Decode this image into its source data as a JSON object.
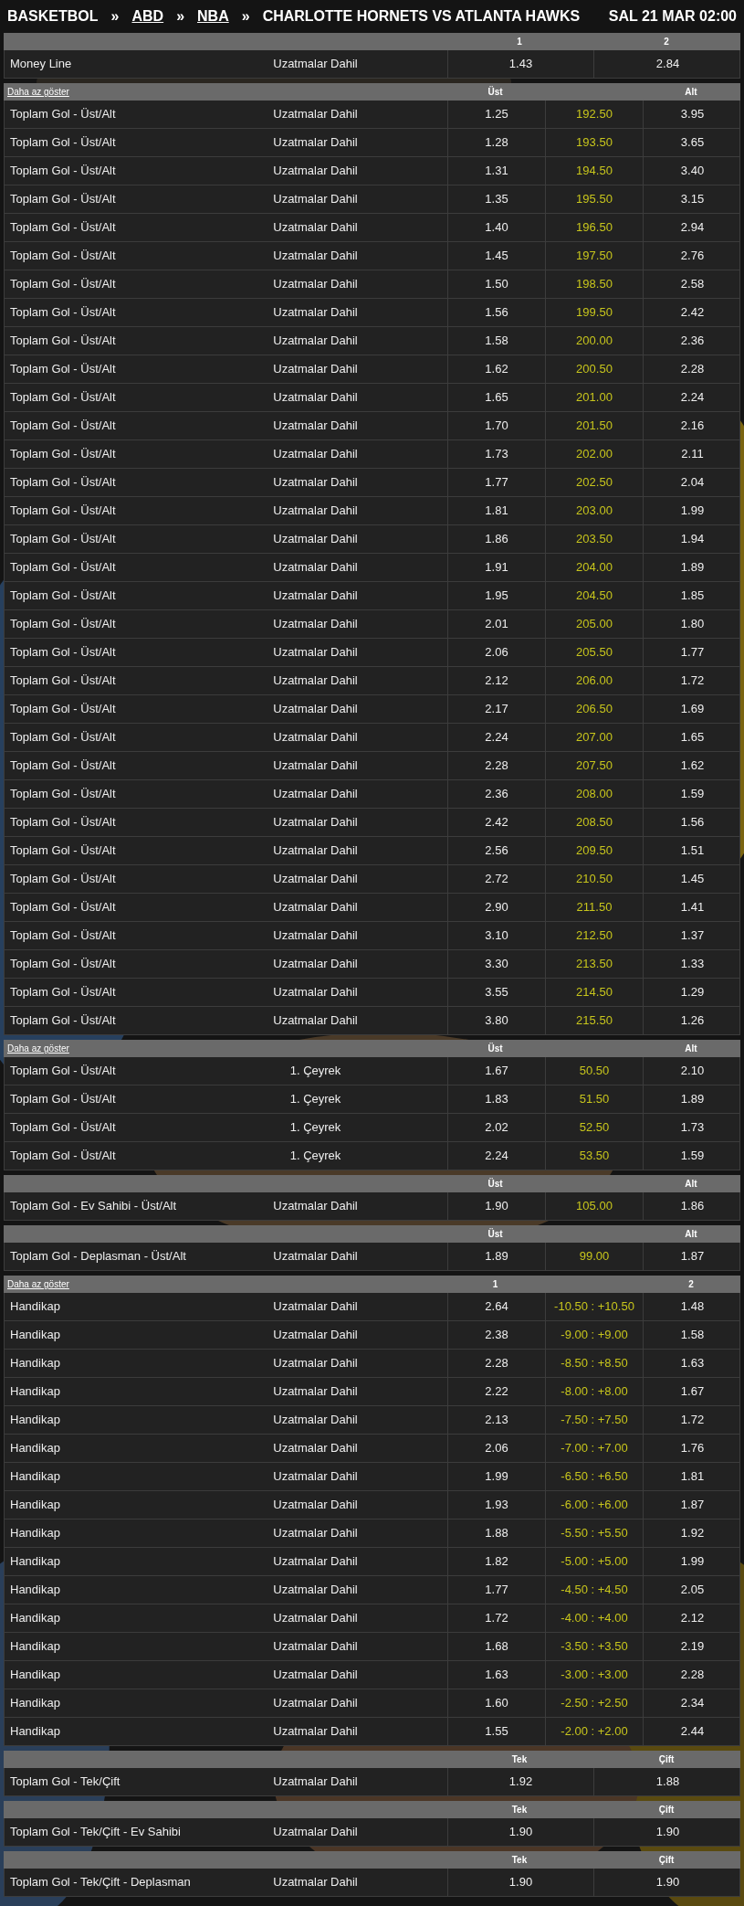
{
  "header": {
    "items": [
      {
        "kind": "text",
        "label": "BASKETBOL"
      },
      {
        "kind": "separator",
        "label": "»"
      },
      {
        "kind": "link",
        "label": "ABD"
      },
      {
        "kind": "separator",
        "label": "»"
      },
      {
        "kind": "link",
        "label": "NBA"
      },
      {
        "kind": "separator",
        "label": "»"
      },
      {
        "kind": "text",
        "label": "CHARLOTTE HORNETS VS ATLANTA HAWKS"
      }
    ],
    "date": "SAL 21 MAR 02:00"
  },
  "markets": [
    {
      "kind": "two-way",
      "headers": [
        "1",
        "2"
      ],
      "rows": [
        {
          "name": "Money Line",
          "period": "Uzatmalar Dahil",
          "odds": [
            "1.43",
            "2.84"
          ]
        }
      ]
    },
    {
      "kind": "three-way",
      "toggle": "Daha az göster",
      "headers": [
        "Üst",
        "Alt"
      ],
      "rows": [
        {
          "name": "Toplam Gol - Üst/Alt",
          "period": "Uzatmalar Dahil",
          "odds": [
            "1.25",
            "192.50",
            "3.95"
          ]
        },
        {
          "name": "Toplam Gol - Üst/Alt",
          "period": "Uzatmalar Dahil",
          "odds": [
            "1.28",
            "193.50",
            "3.65"
          ]
        },
        {
          "name": "Toplam Gol - Üst/Alt",
          "period": "Uzatmalar Dahil",
          "odds": [
            "1.31",
            "194.50",
            "3.40"
          ]
        },
        {
          "name": "Toplam Gol - Üst/Alt",
          "period": "Uzatmalar Dahil",
          "odds": [
            "1.35",
            "195.50",
            "3.15"
          ]
        },
        {
          "name": "Toplam Gol - Üst/Alt",
          "period": "Uzatmalar Dahil",
          "odds": [
            "1.40",
            "196.50",
            "2.94"
          ]
        },
        {
          "name": "Toplam Gol - Üst/Alt",
          "period": "Uzatmalar Dahil",
          "odds": [
            "1.45",
            "197.50",
            "2.76"
          ]
        },
        {
          "name": "Toplam Gol - Üst/Alt",
          "period": "Uzatmalar Dahil",
          "odds": [
            "1.50",
            "198.50",
            "2.58"
          ]
        },
        {
          "name": "Toplam Gol - Üst/Alt",
          "period": "Uzatmalar Dahil",
          "odds": [
            "1.56",
            "199.50",
            "2.42"
          ]
        },
        {
          "name": "Toplam Gol - Üst/Alt",
          "period": "Uzatmalar Dahil",
          "odds": [
            "1.58",
            "200.00",
            "2.36"
          ]
        },
        {
          "name": "Toplam Gol - Üst/Alt",
          "period": "Uzatmalar Dahil",
          "odds": [
            "1.62",
            "200.50",
            "2.28"
          ]
        },
        {
          "name": "Toplam Gol - Üst/Alt",
          "period": "Uzatmalar Dahil",
          "odds": [
            "1.65",
            "201.00",
            "2.24"
          ]
        },
        {
          "name": "Toplam Gol - Üst/Alt",
          "period": "Uzatmalar Dahil",
          "odds": [
            "1.70",
            "201.50",
            "2.16"
          ]
        },
        {
          "name": "Toplam Gol - Üst/Alt",
          "period": "Uzatmalar Dahil",
          "odds": [
            "1.73",
            "202.00",
            "2.11"
          ]
        },
        {
          "name": "Toplam Gol - Üst/Alt",
          "period": "Uzatmalar Dahil",
          "odds": [
            "1.77",
            "202.50",
            "2.04"
          ]
        },
        {
          "name": "Toplam Gol - Üst/Alt",
          "period": "Uzatmalar Dahil",
          "odds": [
            "1.81",
            "203.00",
            "1.99"
          ]
        },
        {
          "name": "Toplam Gol - Üst/Alt",
          "period": "Uzatmalar Dahil",
          "odds": [
            "1.86",
            "203.50",
            "1.94"
          ]
        },
        {
          "name": "Toplam Gol - Üst/Alt",
          "period": "Uzatmalar Dahil",
          "odds": [
            "1.91",
            "204.00",
            "1.89"
          ]
        },
        {
          "name": "Toplam Gol - Üst/Alt",
          "period": "Uzatmalar Dahil",
          "odds": [
            "1.95",
            "204.50",
            "1.85"
          ]
        },
        {
          "name": "Toplam Gol - Üst/Alt",
          "period": "Uzatmalar Dahil",
          "odds": [
            "2.01",
            "205.00",
            "1.80"
          ]
        },
        {
          "name": "Toplam Gol - Üst/Alt",
          "period": "Uzatmalar Dahil",
          "odds": [
            "2.06",
            "205.50",
            "1.77"
          ]
        },
        {
          "name": "Toplam Gol - Üst/Alt",
          "period": "Uzatmalar Dahil",
          "odds": [
            "2.12",
            "206.00",
            "1.72"
          ]
        },
        {
          "name": "Toplam Gol - Üst/Alt",
          "period": "Uzatmalar Dahil",
          "odds": [
            "2.17",
            "206.50",
            "1.69"
          ]
        },
        {
          "name": "Toplam Gol - Üst/Alt",
          "period": "Uzatmalar Dahil",
          "odds": [
            "2.24",
            "207.00",
            "1.65"
          ]
        },
        {
          "name": "Toplam Gol - Üst/Alt",
          "period": "Uzatmalar Dahil",
          "odds": [
            "2.28",
            "207.50",
            "1.62"
          ]
        },
        {
          "name": "Toplam Gol - Üst/Alt",
          "period": "Uzatmalar Dahil",
          "odds": [
            "2.36",
            "208.00",
            "1.59"
          ]
        },
        {
          "name": "Toplam Gol - Üst/Alt",
          "period": "Uzatmalar Dahil",
          "odds": [
            "2.42",
            "208.50",
            "1.56"
          ]
        },
        {
          "name": "Toplam Gol - Üst/Alt",
          "period": "Uzatmalar Dahil",
          "odds": [
            "2.56",
            "209.50",
            "1.51"
          ]
        },
        {
          "name": "Toplam Gol - Üst/Alt",
          "period": "Uzatmalar Dahil",
          "odds": [
            "2.72",
            "210.50",
            "1.45"
          ]
        },
        {
          "name": "Toplam Gol - Üst/Alt",
          "period": "Uzatmalar Dahil",
          "odds": [
            "2.90",
            "211.50",
            "1.41"
          ]
        },
        {
          "name": "Toplam Gol - Üst/Alt",
          "period": "Uzatmalar Dahil",
          "odds": [
            "3.10",
            "212.50",
            "1.37"
          ]
        },
        {
          "name": "Toplam Gol - Üst/Alt",
          "period": "Uzatmalar Dahil",
          "odds": [
            "3.30",
            "213.50",
            "1.33"
          ]
        },
        {
          "name": "Toplam Gol - Üst/Alt",
          "period": "Uzatmalar Dahil",
          "odds": [
            "3.55",
            "214.50",
            "1.29"
          ]
        },
        {
          "name": "Toplam Gol - Üst/Alt",
          "period": "Uzatmalar Dahil",
          "odds": [
            "3.80",
            "215.50",
            "1.26"
          ]
        }
      ]
    },
    {
      "kind": "three-way",
      "toggle": "Daha az göster",
      "headers": [
        "Üst",
        "Alt"
      ],
      "rows": [
        {
          "name": "Toplam Gol - Üst/Alt",
          "period": "1. Çeyrek",
          "odds": [
            "1.67",
            "50.50",
            "2.10"
          ]
        },
        {
          "name": "Toplam Gol - Üst/Alt",
          "period": "1. Çeyrek",
          "odds": [
            "1.83",
            "51.50",
            "1.89"
          ]
        },
        {
          "name": "Toplam Gol - Üst/Alt",
          "period": "1. Çeyrek",
          "odds": [
            "2.02",
            "52.50",
            "1.73"
          ]
        },
        {
          "name": "Toplam Gol - Üst/Alt",
          "period": "1. Çeyrek",
          "odds": [
            "2.24",
            "53.50",
            "1.59"
          ]
        }
      ]
    },
    {
      "kind": "three-way",
      "headers": [
        "Üst",
        "Alt"
      ],
      "rows": [
        {
          "name": "Toplam Gol - Ev Sahibi - Üst/Alt",
          "period": "Uzatmalar Dahil",
          "odds": [
            "1.90",
            "105.00",
            "1.86"
          ]
        }
      ]
    },
    {
      "kind": "three-way",
      "headers": [
        "Üst",
        "Alt"
      ],
      "rows": [
        {
          "name": "Toplam Gol - Deplasman - Üst/Alt",
          "period": "Uzatmalar Dahil",
          "odds": [
            "1.89",
            "99.00",
            "1.87"
          ]
        }
      ]
    },
    {
      "kind": "three-way",
      "toggle": "Daha az göster",
      "headers": [
        "1",
        "2"
      ],
      "rows": [
        {
          "name": "Handikap",
          "period": "Uzatmalar Dahil",
          "odds": [
            "2.64",
            "-10.50 : +10.50",
            "1.48"
          ]
        },
        {
          "name": "Handikap",
          "period": "Uzatmalar Dahil",
          "odds": [
            "2.38",
            "-9.00 : +9.00",
            "1.58"
          ]
        },
        {
          "name": "Handikap",
          "period": "Uzatmalar Dahil",
          "odds": [
            "2.28",
            "-8.50 : +8.50",
            "1.63"
          ]
        },
        {
          "name": "Handikap",
          "period": "Uzatmalar Dahil",
          "odds": [
            "2.22",
            "-8.00 : +8.00",
            "1.67"
          ]
        },
        {
          "name": "Handikap",
          "period": "Uzatmalar Dahil",
          "odds": [
            "2.13",
            "-7.50 : +7.50",
            "1.72"
          ]
        },
        {
          "name": "Handikap",
          "period": "Uzatmalar Dahil",
          "odds": [
            "2.06",
            "-7.00 : +7.00",
            "1.76"
          ]
        },
        {
          "name": "Handikap",
          "period": "Uzatmalar Dahil",
          "odds": [
            "1.99",
            "-6.50 : +6.50",
            "1.81"
          ]
        },
        {
          "name": "Handikap",
          "period": "Uzatmalar Dahil",
          "odds": [
            "1.93",
            "-6.00 : +6.00",
            "1.87"
          ]
        },
        {
          "name": "Handikap",
          "period": "Uzatmalar Dahil",
          "odds": [
            "1.88",
            "-5.50 : +5.50",
            "1.92"
          ]
        },
        {
          "name": "Handikap",
          "period": "Uzatmalar Dahil",
          "odds": [
            "1.82",
            "-5.00 : +5.00",
            "1.99"
          ]
        },
        {
          "name": "Handikap",
          "period": "Uzatmalar Dahil",
          "odds": [
            "1.77",
            "-4.50 : +4.50",
            "2.05"
          ]
        },
        {
          "name": "Handikap",
          "period": "Uzatmalar Dahil",
          "odds": [
            "1.72",
            "-4.00 : +4.00",
            "2.12"
          ]
        },
        {
          "name": "Handikap",
          "period": "Uzatmalar Dahil",
          "odds": [
            "1.68",
            "-3.50 : +3.50",
            "2.19"
          ]
        },
        {
          "name": "Handikap",
          "period": "Uzatmalar Dahil",
          "odds": [
            "1.63",
            "-3.00 : +3.00",
            "2.28"
          ]
        },
        {
          "name": "Handikap",
          "period": "Uzatmalar Dahil",
          "odds": [
            "1.60",
            "-2.50 : +2.50",
            "2.34"
          ]
        },
        {
          "name": "Handikap",
          "period": "Uzatmalar Dahil",
          "odds": [
            "1.55",
            "-2.00 : +2.00",
            "2.44"
          ]
        }
      ]
    },
    {
      "kind": "two-way",
      "headers": [
        "Tek",
        "Çift"
      ],
      "rows": [
        {
          "name": "Toplam Gol - Tek/Çift",
          "period": "Uzatmalar Dahil",
          "odds": [
            "1.92",
            "1.88"
          ]
        }
      ]
    },
    {
      "kind": "two-way",
      "headers": [
        "Tek",
        "Çift"
      ],
      "rows": [
        {
          "name": "Toplam Gol - Tek/Çift - Ev Sahibi",
          "period": "Uzatmalar Dahil",
          "odds": [
            "1.90",
            "1.90"
          ]
        }
      ]
    },
    {
      "kind": "two-way",
      "headers": [
        "Tek",
        "Çift"
      ],
      "rows": [
        {
          "name": "Toplam Gol - Tek/Çift - Deplasman",
          "period": "Uzatmalar Dahil",
          "odds": [
            "1.90",
            "1.90"
          ]
        }
      ]
    }
  ]
}
